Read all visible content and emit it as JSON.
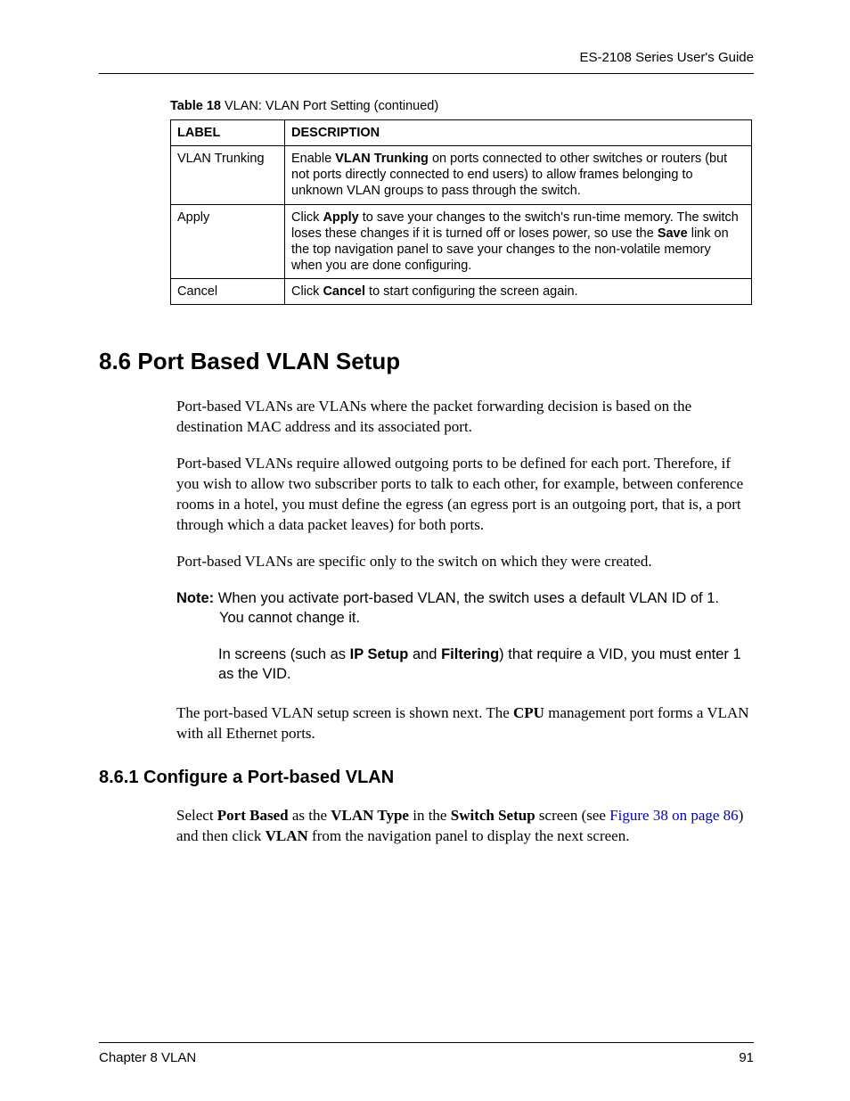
{
  "header": {
    "guide_title": "ES-2108 Series User's Guide"
  },
  "table": {
    "caption_prefix": "Table 18",
    "caption_text": "   VLAN: VLAN Port Setting  (continued)",
    "headers": {
      "label": "LABEL",
      "description": "DESCRIPTION"
    },
    "rows": [
      {
        "label": "VLAN Trunking",
        "desc_pre": "Enable ",
        "desc_bold": "VLAN Trunking",
        "desc_post": " on ports connected to other switches or routers (but not ports directly connected to end users) to allow frames belonging to unknown VLAN groups to pass through the switch."
      },
      {
        "label": "Apply",
        "desc_pre": "Click ",
        "desc_bold": "Apply",
        "desc_mid": " to save your changes to the switch's run-time memory. The switch loses these changes if it is turned off or loses power, so use the ",
        "desc_bold2": "Save",
        "desc_post": " link on the top navigation panel to save your changes to the non-volatile memory when you are done configuring."
      },
      {
        "label": "Cancel",
        "desc_pre": "Click ",
        "desc_bold": "Cancel",
        "desc_post": " to start configuring the screen again."
      }
    ]
  },
  "section": {
    "heading": "8.6  Port Based VLAN Setup",
    "para1": "Port-based VLANs are VLANs where the packet forwarding decision is based on the destination MAC address and its associated port.",
    "para2": "Port-based VLANs require allowed outgoing ports to be defined for each port. Therefore, if you wish to allow two subscriber ports to talk to each other, for example, between conference rooms in a hotel, you must define the egress (an egress port is an outgoing port, that is, a port through which a data packet leaves) for both ports.",
    "para3": "Port-based VLANs are specific only to the switch on which they were created.",
    "note_label": "Note:",
    "note_text": " When you activate port-based VLAN, the switch uses a default VLAN ID of 1. You cannot change it.",
    "note_sub_pre": "In screens (such as ",
    "note_sub_b1": "IP Setup",
    "note_sub_mid": " and ",
    "note_sub_b2": "Filtering",
    "note_sub_post": ") that require a VID, you must enter 1 as the VID.",
    "para4_pre": "The port-based VLAN setup screen is shown next. The ",
    "para4_bold": "CPU",
    "para4_post": " management port forms a VLAN with all Ethernet ports."
  },
  "subsection": {
    "heading": "8.6.1  Configure a Port-based VLAN",
    "para_pre": "Select ",
    "para_b1": "Port Based",
    "para_mid1": " as the ",
    "para_b2": "VLAN Type",
    "para_mid2": " in the ",
    "para_b3": "Switch Setup",
    "para_mid3": " screen (see ",
    "para_link": "Figure 38 on page 86",
    "para_mid4": ") and then click ",
    "para_b4": "VLAN",
    "para_post": " from the navigation panel to display the next screen."
  },
  "footer": {
    "chapter": "Chapter 8 VLAN",
    "page": "91"
  }
}
